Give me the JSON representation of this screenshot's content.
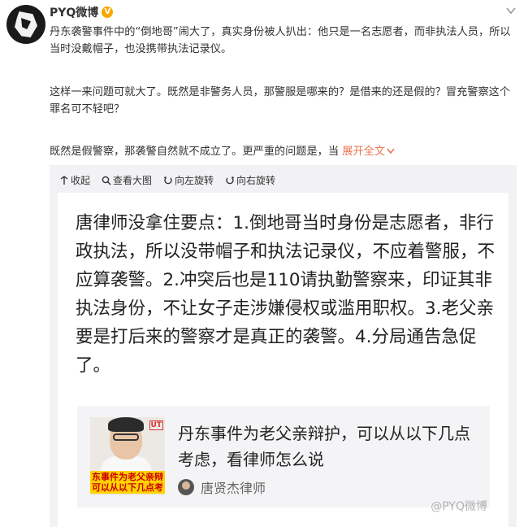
{
  "user": {
    "name": "PYQ微博",
    "badge": "V"
  },
  "post": {
    "paragraph1": "丹东袭警事件中的“倒地哥”闹大了，真实身份被人扒出：他只是一名志愿者，而非执法人员，所以当时没戴帽子，也没携带执法记录仪。",
    "paragraph2": "这样一来问题可就大了。既然是非警务人员，那警服是哪来的？是借来的还是假的？冒充警察这个罪名可不轻吧？",
    "paragraph3": "既然是假警察，那袭警自然就不成立了。更严重的问题是，当",
    "expand_label": "展开全文"
  },
  "toolbar": {
    "collapse": "收起",
    "view_large": "查看大图",
    "rotate_left": "向左旋转",
    "rotate_right": "向右旋转"
  },
  "image": {
    "main_text": "唐律师没拿住要点：1.倒地哥当时身份是志愿者，非行政执法，所以没带帽子和执法记录仪，不应着警服，不应算袭警。2.冲突后也是110请执勤警察来，印证其非执法身份，不让女子走涉嫌侵权或滥用职权。3.老父亲要是打后来的警察才是真正的袭警。4.分局通告急促了。",
    "link_card": {
      "title": "丹东事件为老父亲辩护，可以从以下几点考虑，看律师怎么说",
      "author": "唐贤杰律师",
      "thumb_caption_line1": "东事件为老父亲辩",
      "thumb_caption_line2": "可以从以下几点考",
      "thumb_logo": "UT"
    },
    "watermark": "@PYQ微博"
  },
  "colors": {
    "accent": "#eb7350",
    "vip": "#f7a800"
  }
}
